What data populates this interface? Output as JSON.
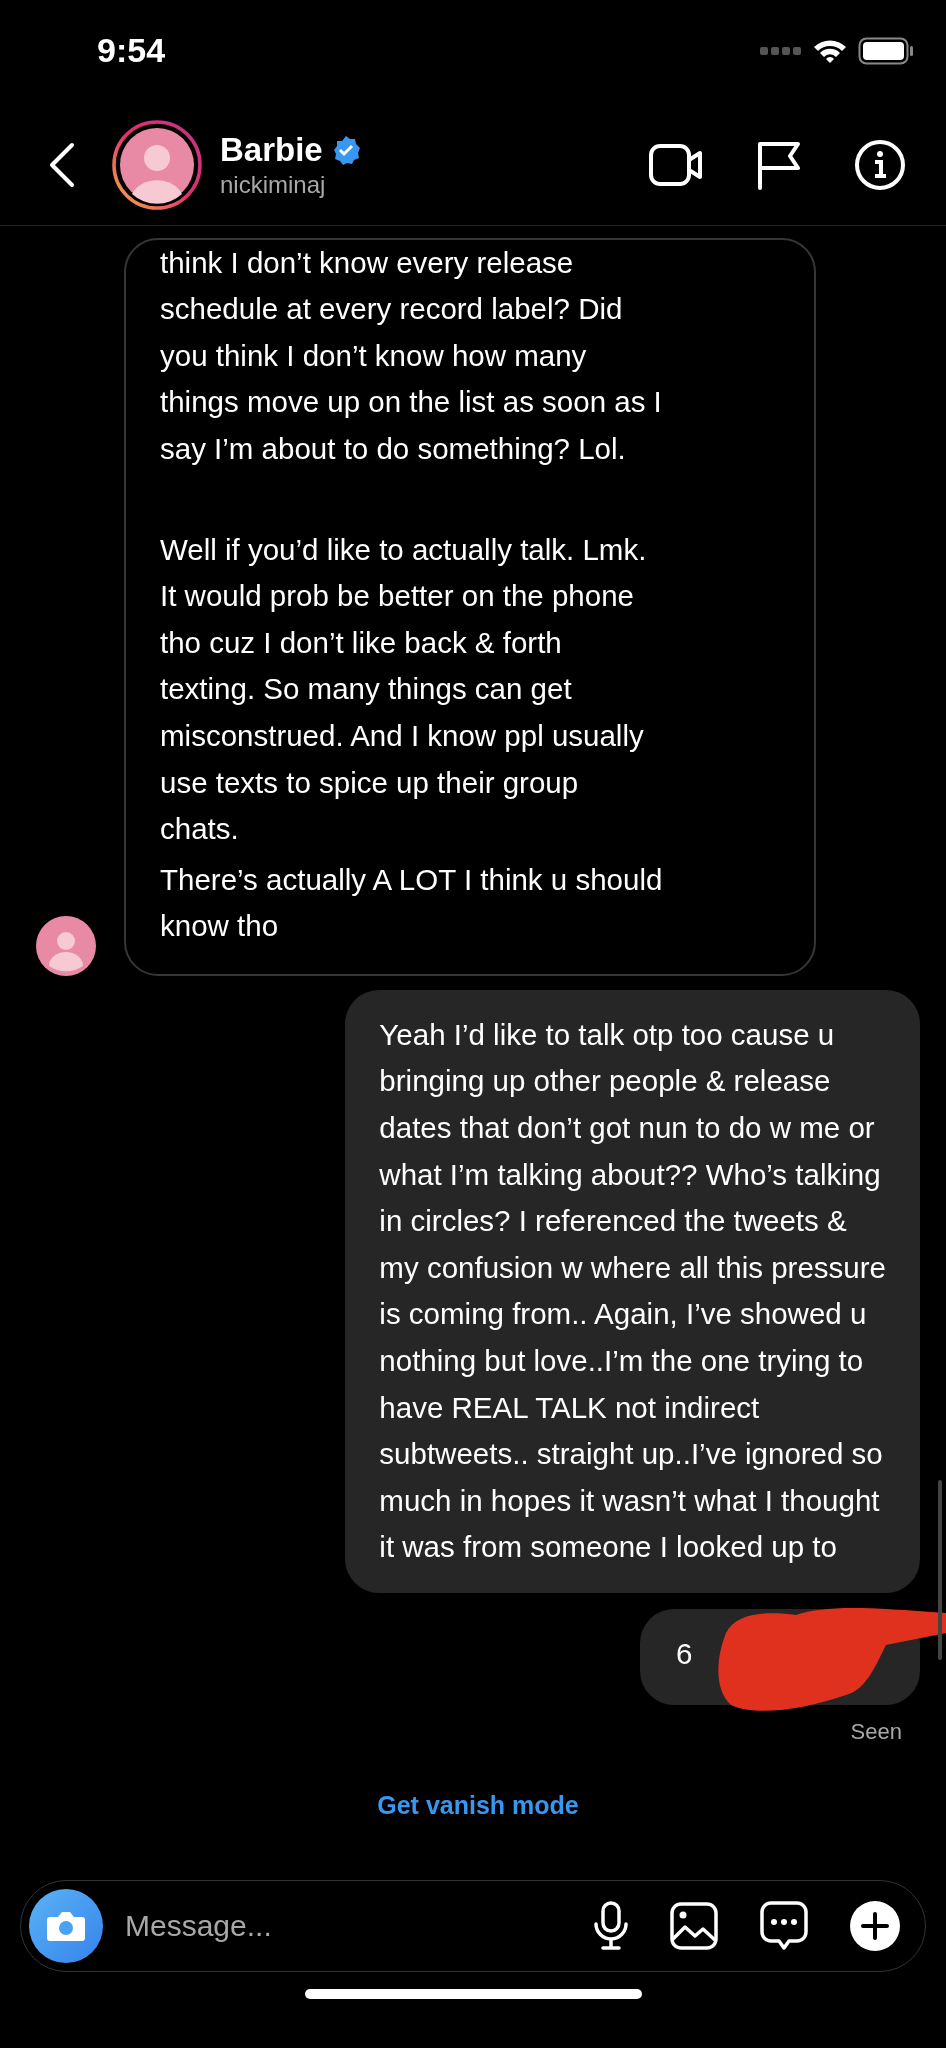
{
  "status_bar": {
    "time": "9:54"
  },
  "header": {
    "name": "Barbie",
    "verified": true,
    "username": "nickiminaj"
  },
  "messages": [
    {
      "kind": "incoming",
      "paragraphs": [
        "think I don’t know every release\nschedule at every record label? Did\nyou think I don’t know how many\nthings move up on the list as soon as I\nsay I’m about to do something? Lol.",
        "Well if you’d like to actually talk. Lmk.\nIt would prob be better on the phone\ntho cuz I don’t like back & forth\ntexting. So many things can get\nmisconstrued. And I know ppl usually\nuse texts to spice up their group\nchats.",
        "There’s actually A LOT I think u should\nknow tho"
      ]
    },
    {
      "kind": "outgoing",
      "paragraphs": [
        "Yeah I’d like to talk otp too cause u\nbringing up other people & release\ndates that don’t got nun to do w me or\nwhat I’m talking about?? Who’s talking\nin circles? I referenced the tweets &\nmy confusion w where all this pressure\nis coming from.. Again, I’ve showed u\nnothing but love..I’m the one trying to\nhave REAL TALK not indirect\nsubtweets.. straight up..I’ve ignored so\nmuch in hopes it wasn’t what I thought\nit was from someone I looked up to"
      ]
    },
    {
      "kind": "outgoing",
      "paragraphs": [
        "6"
      ],
      "redacted": true
    }
  ],
  "receipt": "Seen",
  "vanish_link": "Get vanish mode",
  "composer": {
    "placeholder": "Message..."
  }
}
